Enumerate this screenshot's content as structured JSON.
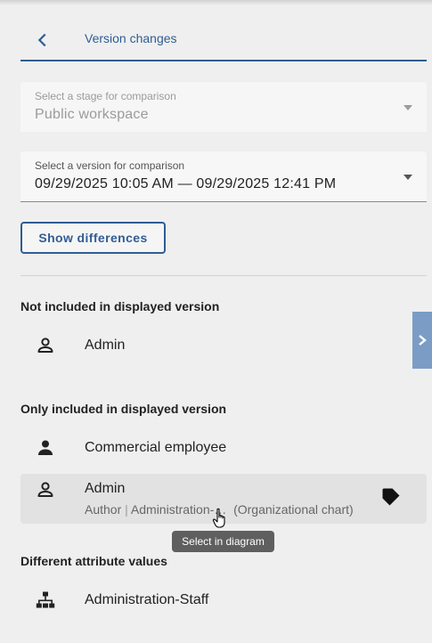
{
  "header": {
    "title": "Version changes",
    "back_icon": "chevron-left-icon"
  },
  "stage_select": {
    "label": "Select a stage for comparison",
    "value": "Public workspace",
    "disabled": true
  },
  "version_select": {
    "label": "Select a version for comparison",
    "value": "09/29/2025 10:05 AM — 09/29/2025 12:41 PM"
  },
  "show_differences_label": "Show differences",
  "sections": {
    "not_included": {
      "title": "Not included in displayed version",
      "items": [
        {
          "label": "Admin",
          "icon": "person-outline-icon"
        }
      ]
    },
    "only_included": {
      "title": "Only included in displayed version",
      "items": [
        {
          "label": "Commercial employee",
          "icon": "person-filled-icon"
        },
        {
          "label": "Admin",
          "icon": "person-outline-icon",
          "sub_role": "Author",
          "sub_separator": "|",
          "sub_object": "Administration-…",
          "sub_model": "(Organizational chart)",
          "action_icon": "tag-icon"
        }
      ]
    },
    "different_attributes": {
      "title": "Different attribute values",
      "items": [
        {
          "label": "Administration-Staff",
          "icon": "org-chart-icon"
        }
      ]
    }
  },
  "tooltip": "Select in diagram",
  "side_tab_icon": "chevron-right-icon",
  "colors": {
    "accent": "#2f5d94",
    "side_tab": "#7b9cc5",
    "background": "#efefef",
    "hover_row": "#e2e2e2",
    "tooltip": "#5f5f5f"
  }
}
